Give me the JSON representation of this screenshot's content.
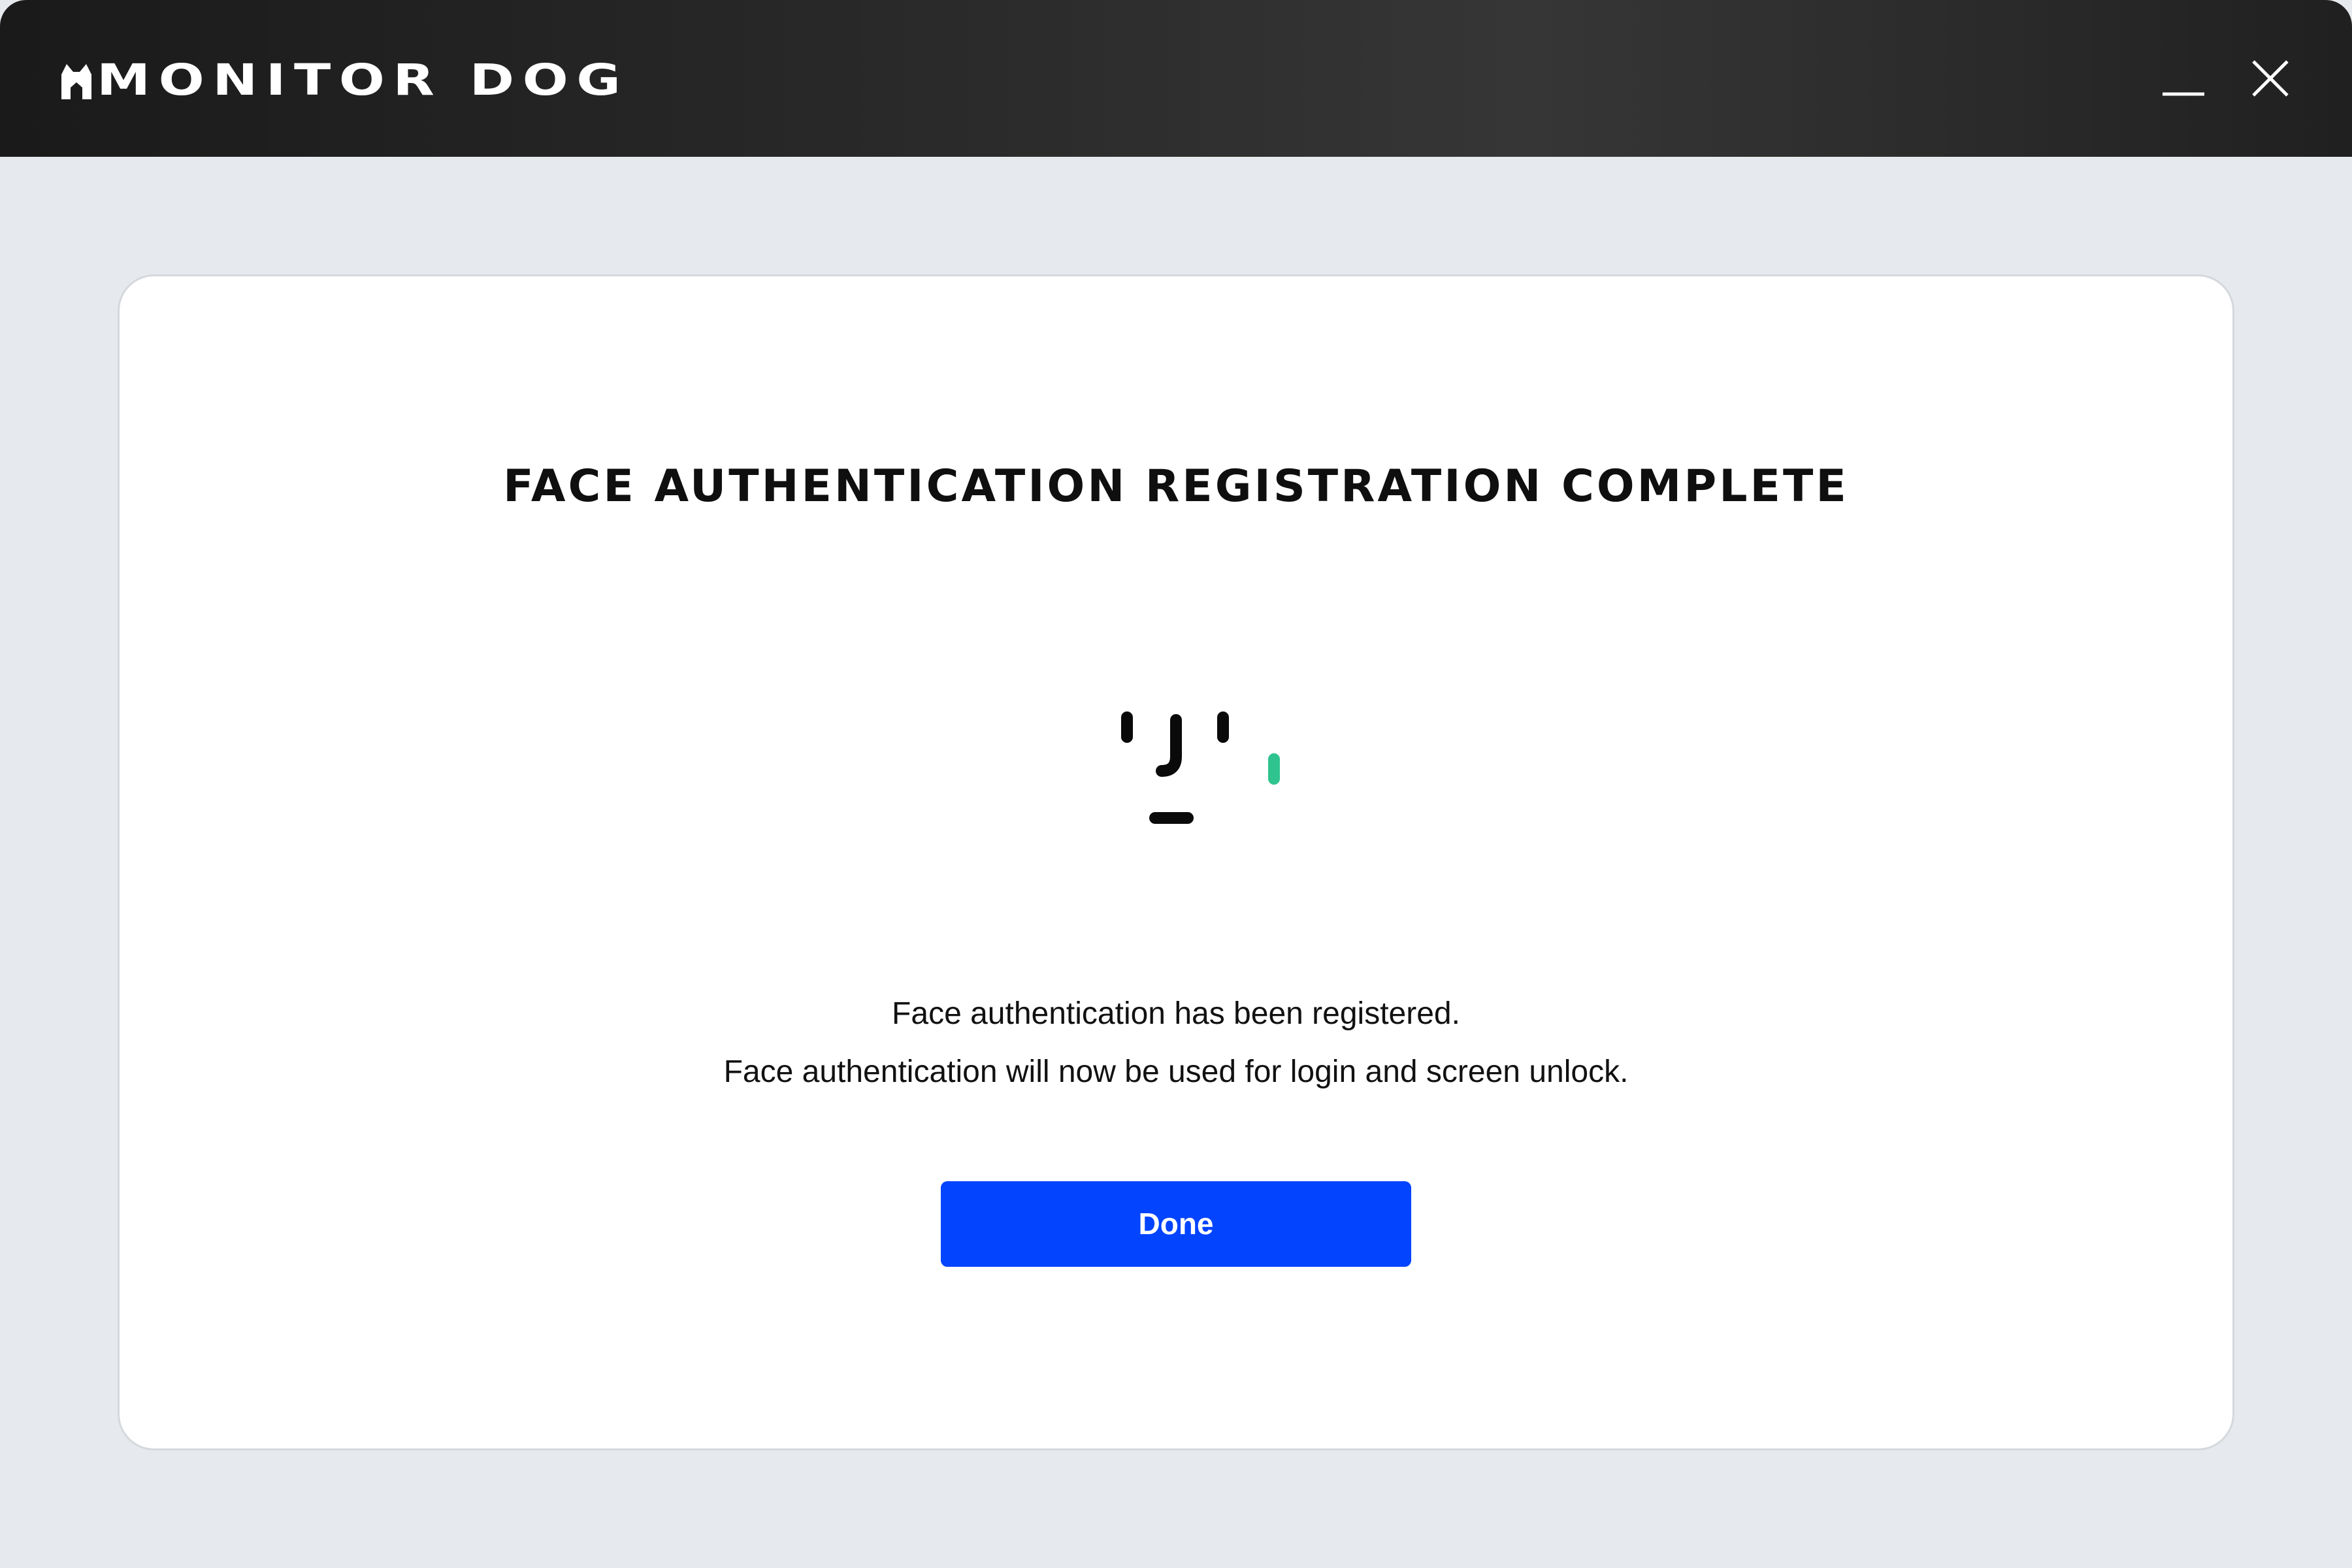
{
  "window": {
    "app_name": "MONITOR DOG",
    "logo_icon": "dog-head-icon",
    "controls": {
      "minimize_icon": "minimize-icon",
      "close_icon": "close-icon"
    }
  },
  "dialog": {
    "title": "FACE AUTHENTICATION REGISTRATION COMPLETE",
    "illustration_icon": "face-id-icon",
    "message_line1": "Face authentication has been registered.",
    "message_line2": "Face authentication will now be used for login and screen unlock.",
    "done_label": "Done"
  },
  "colors": {
    "accent": "#0344ff",
    "success": "#2fc48f",
    "titlebar": "#2a2a2a",
    "background": "#e6e9ee",
    "card": "#ffffff"
  }
}
